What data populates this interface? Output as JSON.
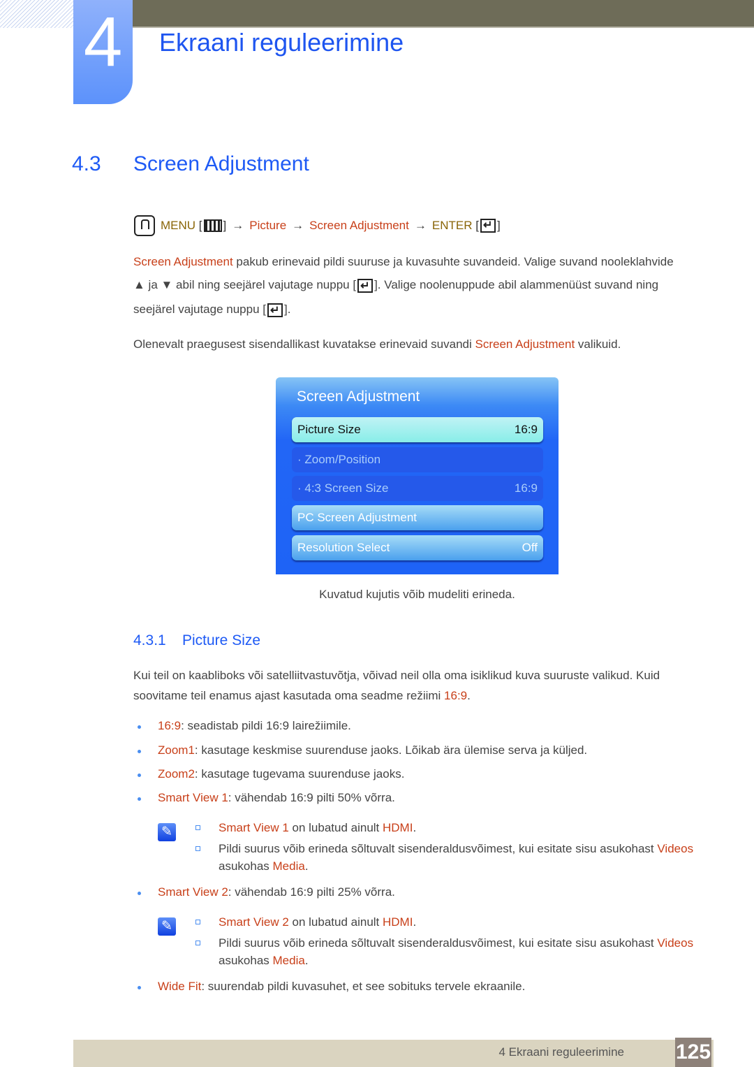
{
  "chapter": {
    "number": "4",
    "title": "Ekraani reguleerimine"
  },
  "section": {
    "number": "4.3",
    "title": "Screen Adjustment"
  },
  "menu_path": {
    "menu": "MENU",
    "picture": "Picture",
    "screen_adjustment": "Screen Adjustment",
    "enter": "ENTER",
    "arrow": "→"
  },
  "intro": {
    "p1_highlight": "Screen Adjustment",
    "p1_rest": " pakub erinevaid pildi suuruse ja kuvasuhte suvandeid. Valige suvand nooleklahvide",
    "p2_a": "▲ ja ▼ abil ning seejärel vajutage nuppu [",
    "p2_b": "]. Valige noolenuppude abil alammenüüst suvand ning",
    "p3_a": "seejärel vajutage nuppu [",
    "p3_b": "].",
    "p4_a": "Olenevalt praegusest sisendallikast kuvatakse erinevaid suvandi ",
    "p4_highlight": "Screen Adjustment",
    "p4_b": " valikuid."
  },
  "tv_menu": {
    "title": "Screen Adjustment",
    "items": [
      {
        "label": "Picture Size",
        "value": "16:9",
        "state": "selected"
      },
      {
        "label": "· Zoom/Position",
        "value": "",
        "state": "disabled"
      },
      {
        "label": "· 4:3 Screen Size",
        "value": "16:9",
        "state": "disabled"
      },
      {
        "label": "PC Screen Adjustment",
        "value": "",
        "state": "normal"
      },
      {
        "label": "Resolution Select",
        "value": "Off",
        "state": "normal"
      }
    ]
  },
  "caption": "Kuvatud kujutis võib mudeliti erineda.",
  "subsection": {
    "number": "4.3.1",
    "title": "Picture Size"
  },
  "subsection_intro": {
    "line1": "Kui teil on kaabliboks või satelliitvastuvõtja, võivad neil olla oma isiklikud kuva suuruste valikud. Kuid",
    "line2_a": "soovitame teil enamus ajast kasutada oma seadme režiimi ",
    "line2_highlight": "16:9",
    "line2_b": "."
  },
  "bullets": [
    {
      "term": "16:9",
      "desc": ": seadistab pildi 16:9 lairežiimile."
    },
    {
      "term": "Zoom1",
      "desc": ": kasutage keskmise suurenduse jaoks. Lõikab ära ülemise serva ja küljed."
    },
    {
      "term": "Zoom2",
      "desc": ": kasutage tugevama suurenduse jaoks."
    },
    {
      "term": "Smart View 1",
      "desc": ": vähendab 16:9 pilti 50% võrra."
    },
    {
      "term": "Smart View 2",
      "desc": ": vähendab 16:9 pilti 25% võrra."
    },
    {
      "term": "Wide Fit",
      "desc": ": suurendab pildi kuvasuhet, et see sobituks tervele ekraanile."
    }
  ],
  "notes": [
    {
      "line1_term": "Smart View 1",
      "line1_mid": " on lubatud ainult ",
      "line1_term2": "HDMI",
      "line1_end": ".",
      "line2_a": "Pildi suurus võib erineda sõltuvalt sisenderaldusvõimest, kui esitate sisu asukohast ",
      "line2_term": "Videos",
      "line3_a": "asukohas ",
      "line3_term": "Media",
      "line3_end": "."
    },
    {
      "line1_term": "Smart View 2",
      "line1_mid": " on lubatud ainult ",
      "line1_term2": "HDMI",
      "line1_end": ".",
      "line2_a": "Pildi suurus võib erineda sõltuvalt sisenderaldusvõimest, kui esitate sisu asukohast ",
      "line2_term": "Videos",
      "line3_a": "asukohas ",
      "line3_term": "Media",
      "line3_end": "."
    }
  ],
  "footer": {
    "chapter_label": "4 Ekraani reguleerimine",
    "page": "125"
  }
}
